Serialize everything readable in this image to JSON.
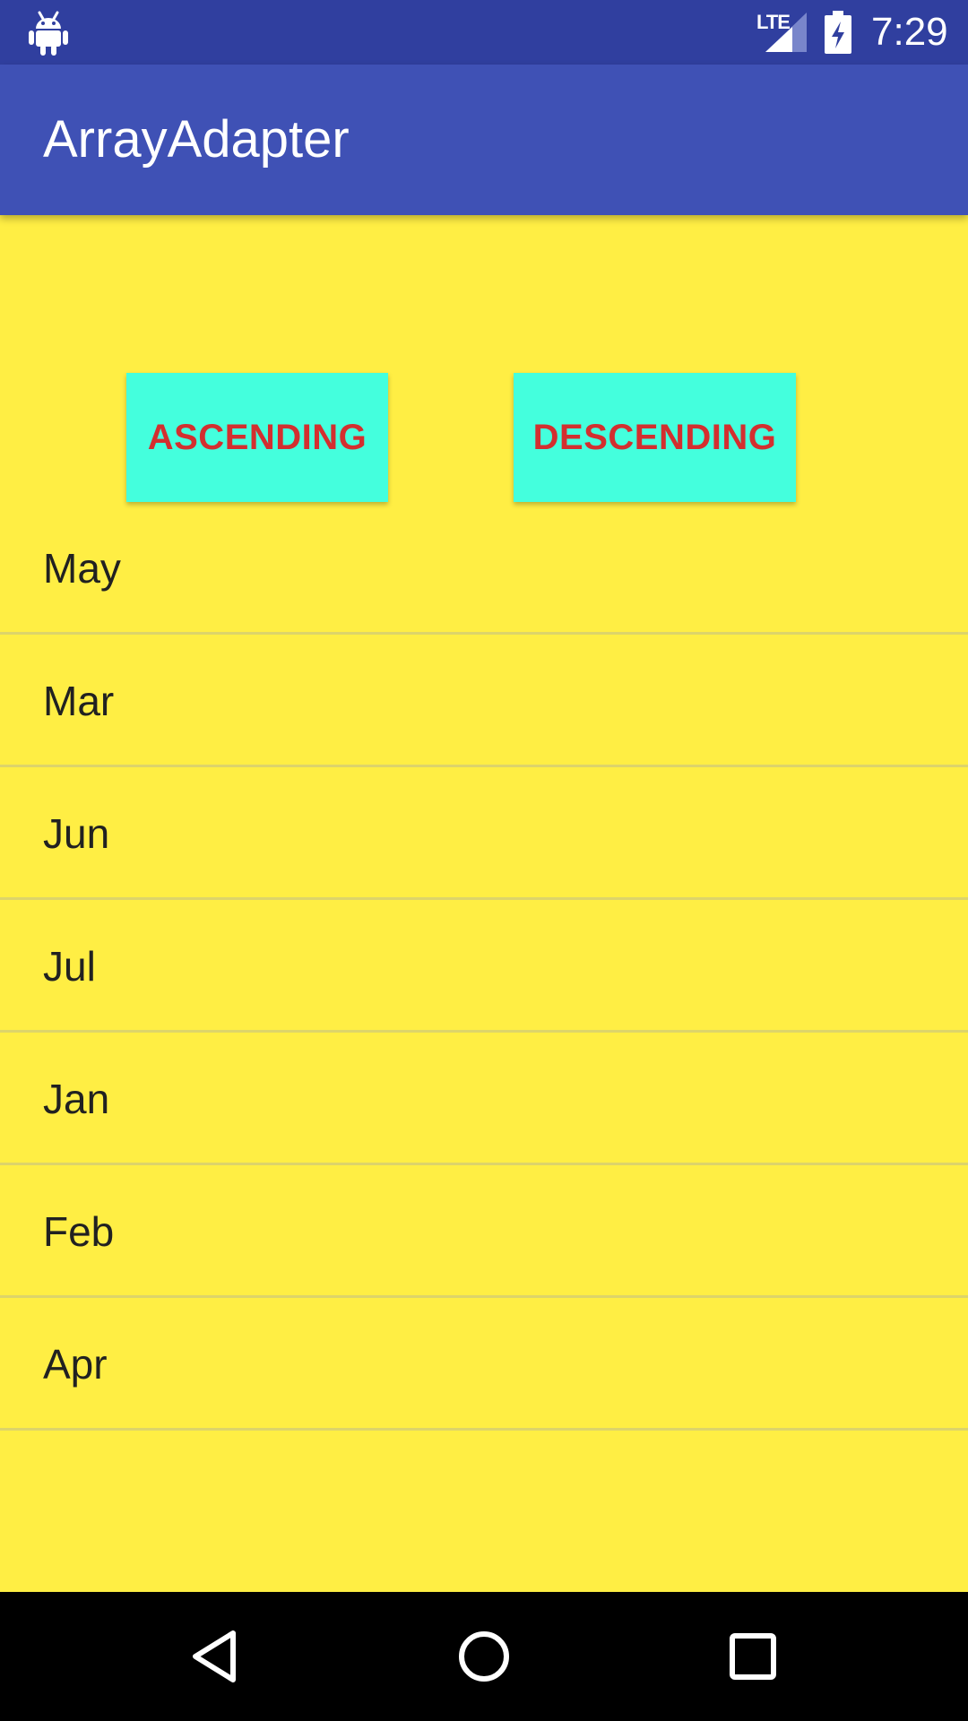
{
  "status_bar": {
    "network_label": "LTE",
    "time": "7:29",
    "icons": [
      "android-icon",
      "signal-icon",
      "battery-charging-icon"
    ]
  },
  "app_bar": {
    "title": "ArrayAdapter"
  },
  "buttons": {
    "ascending_label": "ASCENDING",
    "descending_label": "DESCENDING"
  },
  "months": [
    {
      "label": "May"
    },
    {
      "label": "Mar"
    },
    {
      "label": "Jun"
    },
    {
      "label": "Jul"
    },
    {
      "label": "Jan"
    },
    {
      "label": "Feb"
    },
    {
      "label": "Apr"
    }
  ],
  "nav_bar": {
    "icons": [
      "back-icon",
      "home-icon",
      "recents-icon"
    ]
  },
  "colors": {
    "status_bar": "#303F9F",
    "app_bar": "#3F51B5",
    "background": "#FFEE44",
    "button_background": "#44FFDD",
    "button_text": "#D32F2F",
    "list_text": "#212121",
    "divider": "#DDD46A",
    "nav_bar": "#000000"
  }
}
